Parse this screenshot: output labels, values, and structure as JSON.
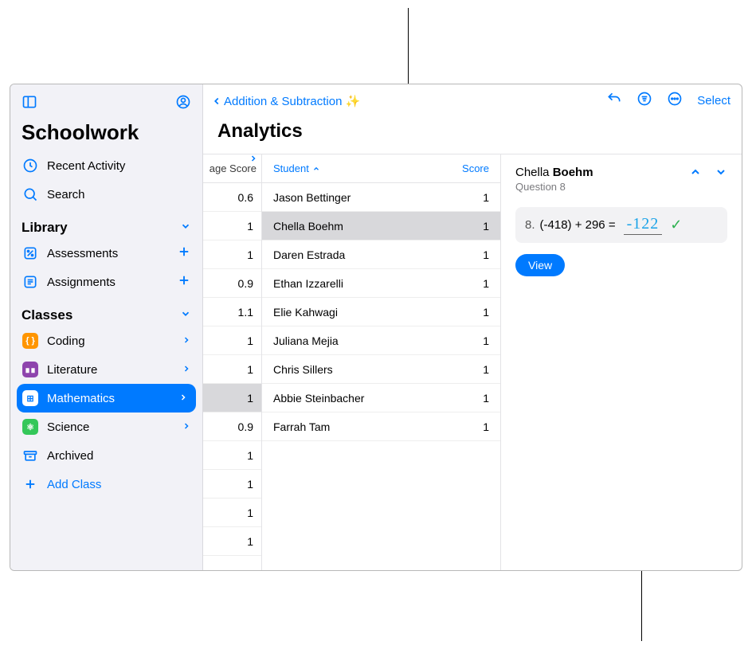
{
  "sidebar": {
    "app_title": "Schoolwork",
    "recent": "Recent Activity",
    "search": "Search",
    "library_head": "Library",
    "assessments": "Assessments",
    "assignments": "Assignments",
    "classes_head": "Classes",
    "coding": "Coding",
    "literature": "Literature",
    "mathematics": "Mathematics",
    "science": "Science",
    "archived": "Archived",
    "add_class": "Add Class"
  },
  "main": {
    "back_label": "Addition & Subtraction ✨",
    "select_label": "Select",
    "title": "Analytics",
    "avg_score_head": "age Score",
    "student_head": "Student",
    "score_head": "Score",
    "avg_scores": [
      "0.6",
      "1",
      "1",
      "0.9",
      "1.1",
      "1",
      "1",
      "1",
      "0.9",
      "1",
      "1",
      "1",
      "1"
    ],
    "selected_avg_idx": 7,
    "students": [
      {
        "name": "Jason Bettinger",
        "score": "1"
      },
      {
        "name": "Chella Boehm",
        "score": "1"
      },
      {
        "name": "Daren Estrada",
        "score": "1"
      },
      {
        "name": "Ethan Izzarelli",
        "score": "1"
      },
      {
        "name": "Elie Kahwagi",
        "score": "1"
      },
      {
        "name": "Juliana Mejia",
        "score": "1"
      },
      {
        "name": "Chris Sillers",
        "score": "1"
      },
      {
        "name": "Abbie Steinbacher",
        "score": "1"
      },
      {
        "name": "Farrah Tam",
        "score": "1"
      }
    ],
    "selected_student_idx": 1
  },
  "detail": {
    "first": "Chella",
    "last": "Boehm",
    "question_label": "Question 8",
    "q_num": "8.",
    "q_text": "(-418) + 296 =",
    "answer": "-122",
    "view_label": "View"
  }
}
